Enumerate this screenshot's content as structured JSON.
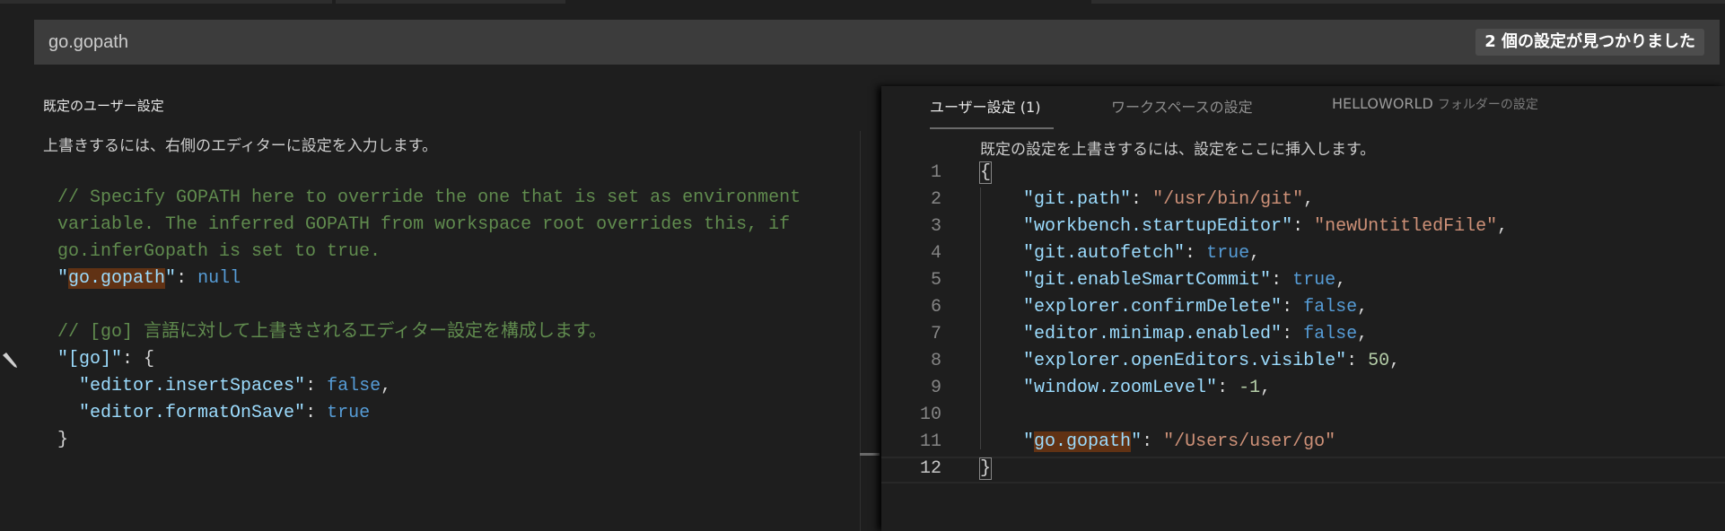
{
  "search": {
    "value": "go.gopath",
    "result_badge": "2 個の設定が見つかりました"
  },
  "left": {
    "header": "既定のユーザー設定",
    "description": "上書きするには、右側のエディターに設定を入力します。",
    "lines": [
      [
        [
          "c",
          "// Specify GOPATH here to override the one that is set as environment"
        ]
      ],
      [
        [
          "c",
          "variable. The inferred GOPATH from workspace root overrides this, if"
        ]
      ],
      [
        [
          "c",
          "go.inferGopath is set to true."
        ]
      ],
      [
        [
          "k",
          "\""
        ],
        [
          "k hl",
          "go.gopath"
        ],
        [
          "k",
          "\""
        ],
        [
          "p",
          ": "
        ],
        [
          "b",
          "null"
        ]
      ],
      [],
      [
        [
          "c",
          "// [go] 言語に対して上書きされるエディター設定を構成します。"
        ]
      ],
      [
        [
          "k",
          "\"[go]\""
        ],
        [
          "p",
          ": {"
        ]
      ],
      [
        [
          "p",
          "  "
        ],
        [
          "k",
          "\"editor.insertSpaces\""
        ],
        [
          "p",
          ": "
        ],
        [
          "b",
          "false"
        ],
        [
          "p",
          ","
        ]
      ],
      [
        [
          "p",
          "  "
        ],
        [
          "k",
          "\"editor.formatOnSave\""
        ],
        [
          "p",
          ": "
        ],
        [
          "b",
          "true"
        ]
      ],
      [
        [
          "p",
          "}"
        ]
      ]
    ]
  },
  "right": {
    "tabs": [
      {
        "label": "ユーザー設定 (1)",
        "active": true
      },
      {
        "label": "ワークスペースの設定"
      },
      {
        "label": "HELLOWORLD",
        "sub": "フォルダーの設定"
      }
    ],
    "description": "既定の設定を上書きするには、設定をここに挿入します。",
    "line_numbers": [
      "1",
      "2",
      "3",
      "4",
      "5",
      "6",
      "7",
      "8",
      "9",
      "10",
      "11",
      "12"
    ],
    "current_line": 12,
    "lines": [
      [
        [
          "p brk",
          "{"
        ]
      ],
      [
        [
          "p",
          "    "
        ],
        [
          "k",
          "\"git.path\""
        ],
        [
          "p",
          ": "
        ],
        [
          "s",
          "\"/usr/bin/git\""
        ],
        [
          "p",
          ","
        ]
      ],
      [
        [
          "p",
          "    "
        ],
        [
          "k",
          "\"workbench.startupEditor\""
        ],
        [
          "p",
          ": "
        ],
        [
          "s",
          "\"newUntitledFile\""
        ],
        [
          "p",
          ","
        ]
      ],
      [
        [
          "p",
          "    "
        ],
        [
          "k",
          "\"git.autofetch\""
        ],
        [
          "p",
          ": "
        ],
        [
          "b",
          "true"
        ],
        [
          "p",
          ","
        ]
      ],
      [
        [
          "p",
          "    "
        ],
        [
          "k",
          "\"git.enableSmartCommit\""
        ],
        [
          "p",
          ": "
        ],
        [
          "b",
          "true"
        ],
        [
          "p",
          ","
        ]
      ],
      [
        [
          "p",
          "    "
        ],
        [
          "k",
          "\"explorer.confirmDelete\""
        ],
        [
          "p",
          ": "
        ],
        [
          "b",
          "false"
        ],
        [
          "p",
          ","
        ]
      ],
      [
        [
          "p",
          "    "
        ],
        [
          "k",
          "\"editor.minimap.enabled\""
        ],
        [
          "p",
          ": "
        ],
        [
          "b",
          "false"
        ],
        [
          "p",
          ","
        ]
      ],
      [
        [
          "p",
          "    "
        ],
        [
          "k",
          "\"explorer.openEditors.visible\""
        ],
        [
          "p",
          ": "
        ],
        [
          "n",
          "50"
        ],
        [
          "p",
          ","
        ]
      ],
      [
        [
          "p",
          "    "
        ],
        [
          "k",
          "\"window.zoomLevel\""
        ],
        [
          "p",
          ": "
        ],
        [
          "n",
          "-1"
        ],
        [
          "p",
          ","
        ]
      ],
      [],
      [
        [
          "p",
          "    "
        ],
        [
          "k",
          "\""
        ],
        [
          "k hl",
          "go.gopath"
        ],
        [
          "k",
          "\""
        ],
        [
          "p",
          ": "
        ],
        [
          "s",
          "\"/Users/user/go\""
        ]
      ],
      [
        [
          "p brk",
          "}"
        ]
      ]
    ]
  }
}
